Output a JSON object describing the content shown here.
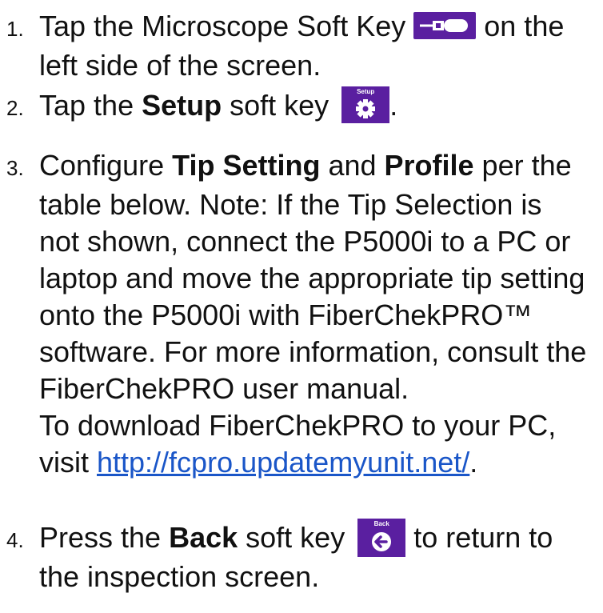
{
  "steps": [
    {
      "number": "1.",
      "text_a": "Tap the Microscope Soft Key",
      "icon": "microscope-icon",
      "text_b": "on the",
      "line2": "left side of the screen."
    },
    {
      "number": "2.",
      "text_a": "Tap the ",
      "bold": "Setup",
      "text_b": " soft key",
      "icon_label": "Setup",
      "icon": "gear-icon",
      "text_c": "."
    },
    {
      "number": "3.",
      "text_a": "Configure ",
      "bold1": "Tip Setting",
      "mid": " and ",
      "bold2": "Profile",
      "text_b": " per the",
      "lines": [
        "table below.  Note:  If the Tip Selection is",
        "not shown, connect the P5000i to a PC or",
        "laptop and move the appropriate tip setting",
        "onto the P5000i with FiberChekPRO™",
        "software. For more information, consult the",
        "FiberChekPRO user manual.",
        "To download FiberChekPRO to your PC,"
      ],
      "visit": "visit ",
      "url": "http://fcpro.updatemyunit.net/",
      "after_url": "."
    },
    {
      "number": "4.",
      "text_a": "Press the ",
      "bold": "Back",
      "text_b": " soft key",
      "icon_label": "Back",
      "icon": "back-arrow-icon",
      "text_c": " to return to",
      "line2": "the inspection screen."
    }
  ],
  "colors": {
    "softkey": "#5a1fa0",
    "link": "#1a56c8"
  }
}
